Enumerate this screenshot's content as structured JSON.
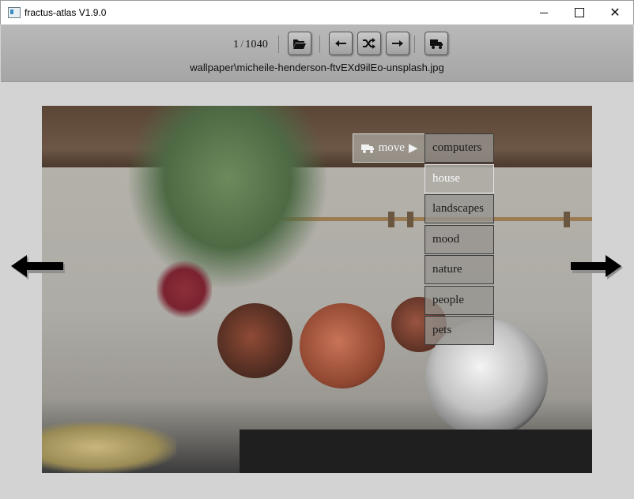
{
  "window": {
    "title": "fractus-atlas V1.9.0",
    "controls": [
      "minimize",
      "maximize",
      "close"
    ]
  },
  "toolbar": {
    "counter_current": "1",
    "counter_sep": "/",
    "counter_total": "1040",
    "buttons": [
      {
        "name": "open-folder",
        "icon": "folder-open-icon"
      },
      {
        "name": "previous",
        "icon": "arrow-left-icon"
      },
      {
        "name": "shuffle",
        "icon": "shuffle-icon"
      },
      {
        "name": "next",
        "icon": "arrow-right-icon"
      },
      {
        "name": "move",
        "icon": "truck-icon"
      }
    ],
    "filename": "wallpaper\\micheile-henderson-ftvEXd9ilEo-unsplash.jpg"
  },
  "overlay": {
    "move_label": "move",
    "move_menu": [
      "computers",
      "house",
      "landscapes",
      "mood",
      "nature",
      "people",
      "pets"
    ],
    "selected": "house"
  },
  "colors": {
    "background": "#d3d3d3",
    "toolbar": "#b0b0b0",
    "menu_item": "#96948e"
  }
}
